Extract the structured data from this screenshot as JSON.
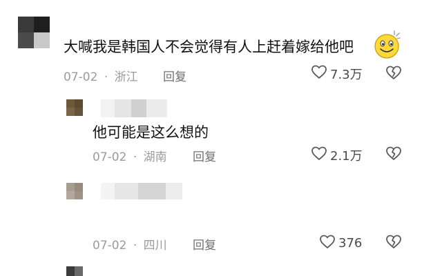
{
  "comments": [
    {
      "text": "大喊我是韩国人不会觉得有人上赶着嫁给他吧",
      "date": "07-02",
      "separator": "·",
      "location": "浙江",
      "reply_label": "回复",
      "likes": "7.3万"
    },
    {
      "text": "他可能是这么想的",
      "date": "07-02",
      "separator": "·",
      "location": "湖南",
      "reply_label": "回复",
      "likes": "2.1万"
    },
    {
      "text": "",
      "date": "07-02",
      "separator": "·",
      "location": "四川",
      "reply_label": "回复",
      "likes": "376"
    }
  ],
  "icons": {
    "like": "heart-outline-icon",
    "dislike": "broken-heart-icon",
    "emoji": "grinning-face-emoji"
  },
  "colors": {
    "meta_text": "#9b9b9b",
    "body_text": "#111111"
  }
}
